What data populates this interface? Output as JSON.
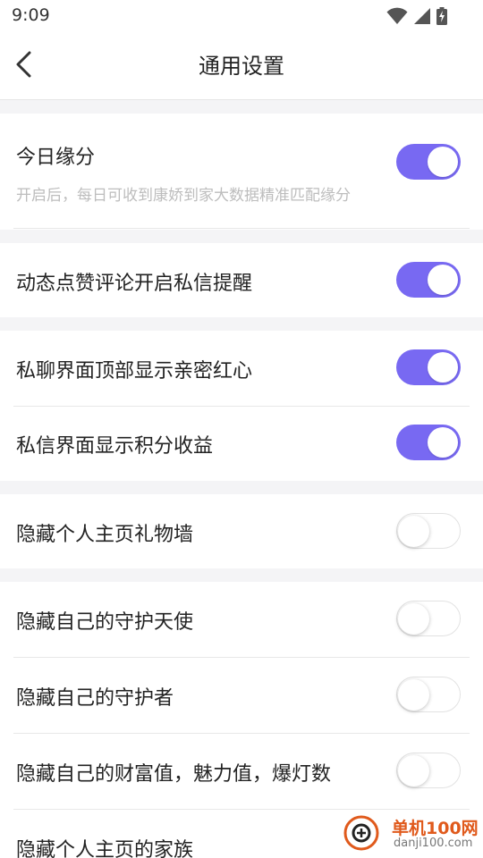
{
  "status_bar": {
    "time": "9:09"
  },
  "header": {
    "title": "通用设置"
  },
  "settings": [
    {
      "label": "今日缘分",
      "subtitle": "开启后，每日可收到康娇到家大数据精准匹配缘分",
      "enabled": true
    },
    {
      "label": "动态点赞评论开启私信提醒",
      "enabled": true
    },
    {
      "label": "私聊界面顶部显示亲密红心",
      "enabled": true
    },
    {
      "label": "私信界面显示积分收益",
      "enabled": true
    },
    {
      "label": "隐藏个人主页礼物墙",
      "enabled": false
    },
    {
      "label": "隐藏自己的守护天使",
      "enabled": false
    },
    {
      "label": "隐藏自己的守护者",
      "enabled": false
    },
    {
      "label": "隐藏自己的财富值，魅力值，爆灯数",
      "enabled": false
    },
    {
      "label": "隐藏个人主页的家族",
      "enabled": false
    }
  ],
  "watermark": {
    "text_cn": "单机100网",
    "text_en": "danji100.com"
  },
  "colors": {
    "toggle_on": "#7869f2",
    "accent_watermark": "#e05a1c"
  },
  "icons": [
    "wifi-icon",
    "signal-icon",
    "battery-charging-icon",
    "back-arrow-icon"
  ]
}
